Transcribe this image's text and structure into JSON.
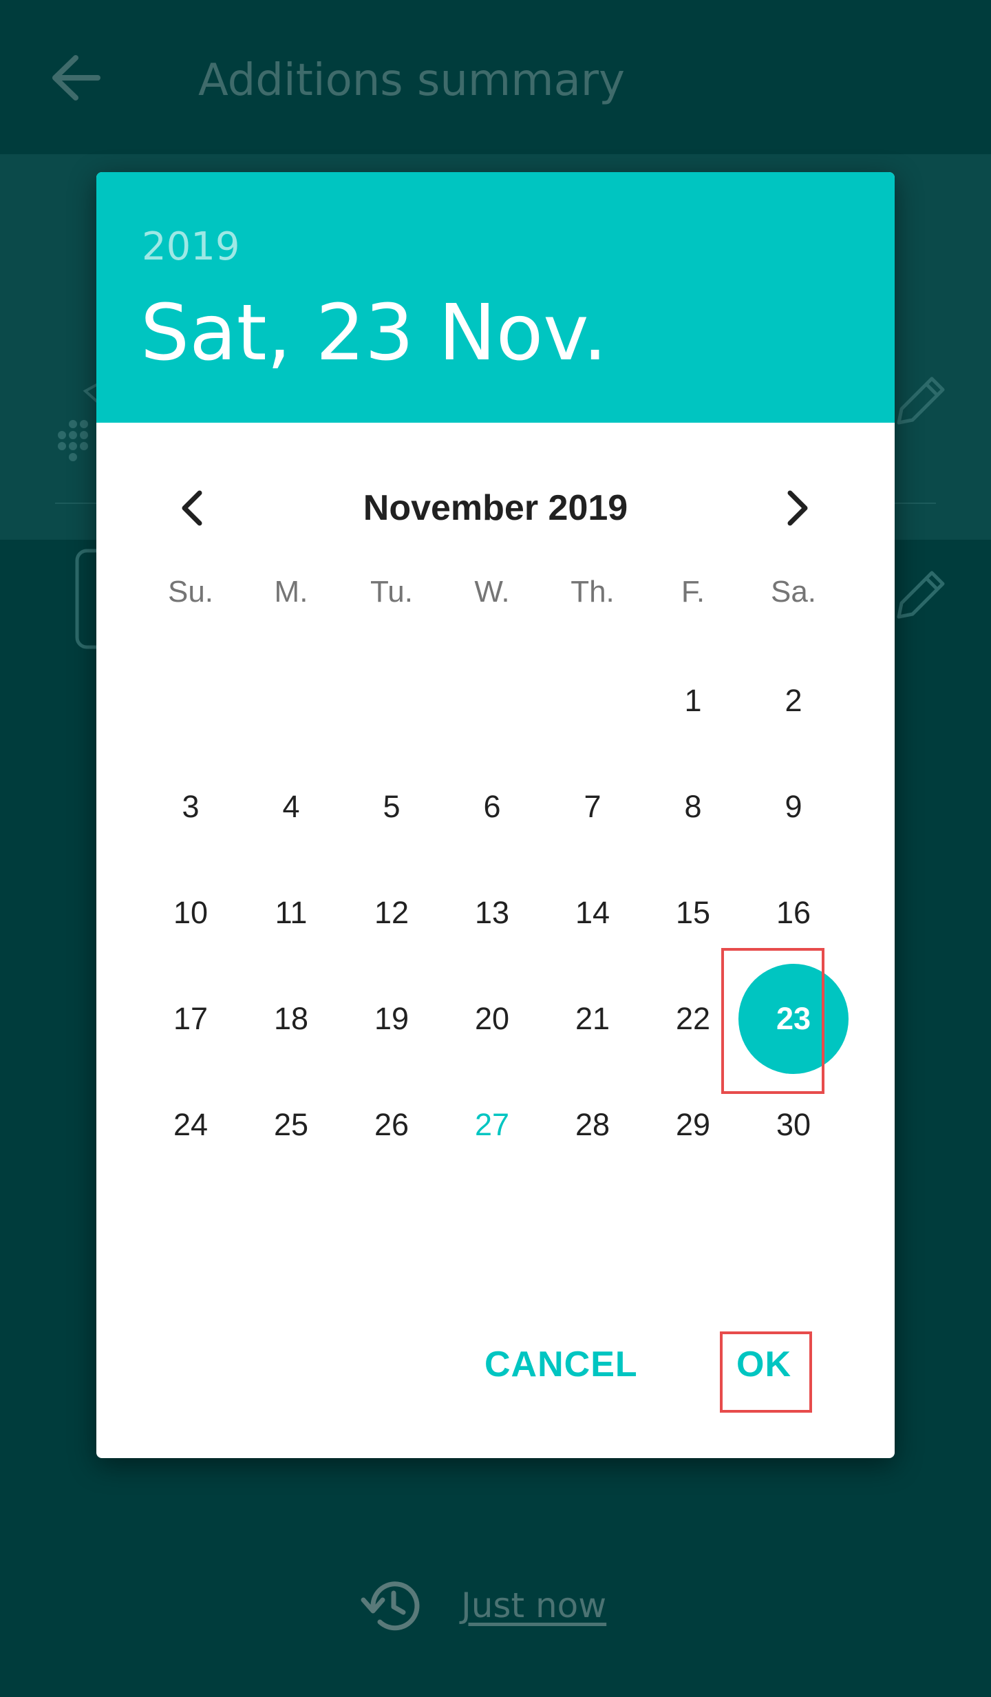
{
  "appbar": {
    "title": "Additions summary"
  },
  "history": {
    "link_label": "Just now"
  },
  "dialog": {
    "year": "2019",
    "selected_date": "Sat, 23 Nov.",
    "month_label": "November 2019",
    "weekdays": [
      "Su.",
      "M.",
      "Tu.",
      "W.",
      "Th.",
      "F.",
      "Sa."
    ],
    "first_weekday_index": 5,
    "days_in_month": 30,
    "selected_day": 23,
    "today_day": 27,
    "cancel_label": "CANCEL",
    "ok_label": "OK"
  },
  "colors": {
    "accent": "#00c5c1",
    "scrim_background": "#003c3c",
    "highlight": "#e74c4c"
  },
  "icons": {
    "back": "arrow-left-icon",
    "prev": "chevron-left-icon",
    "next": "chevron-right-icon",
    "edit": "pencil-icon",
    "history": "history-icon"
  }
}
